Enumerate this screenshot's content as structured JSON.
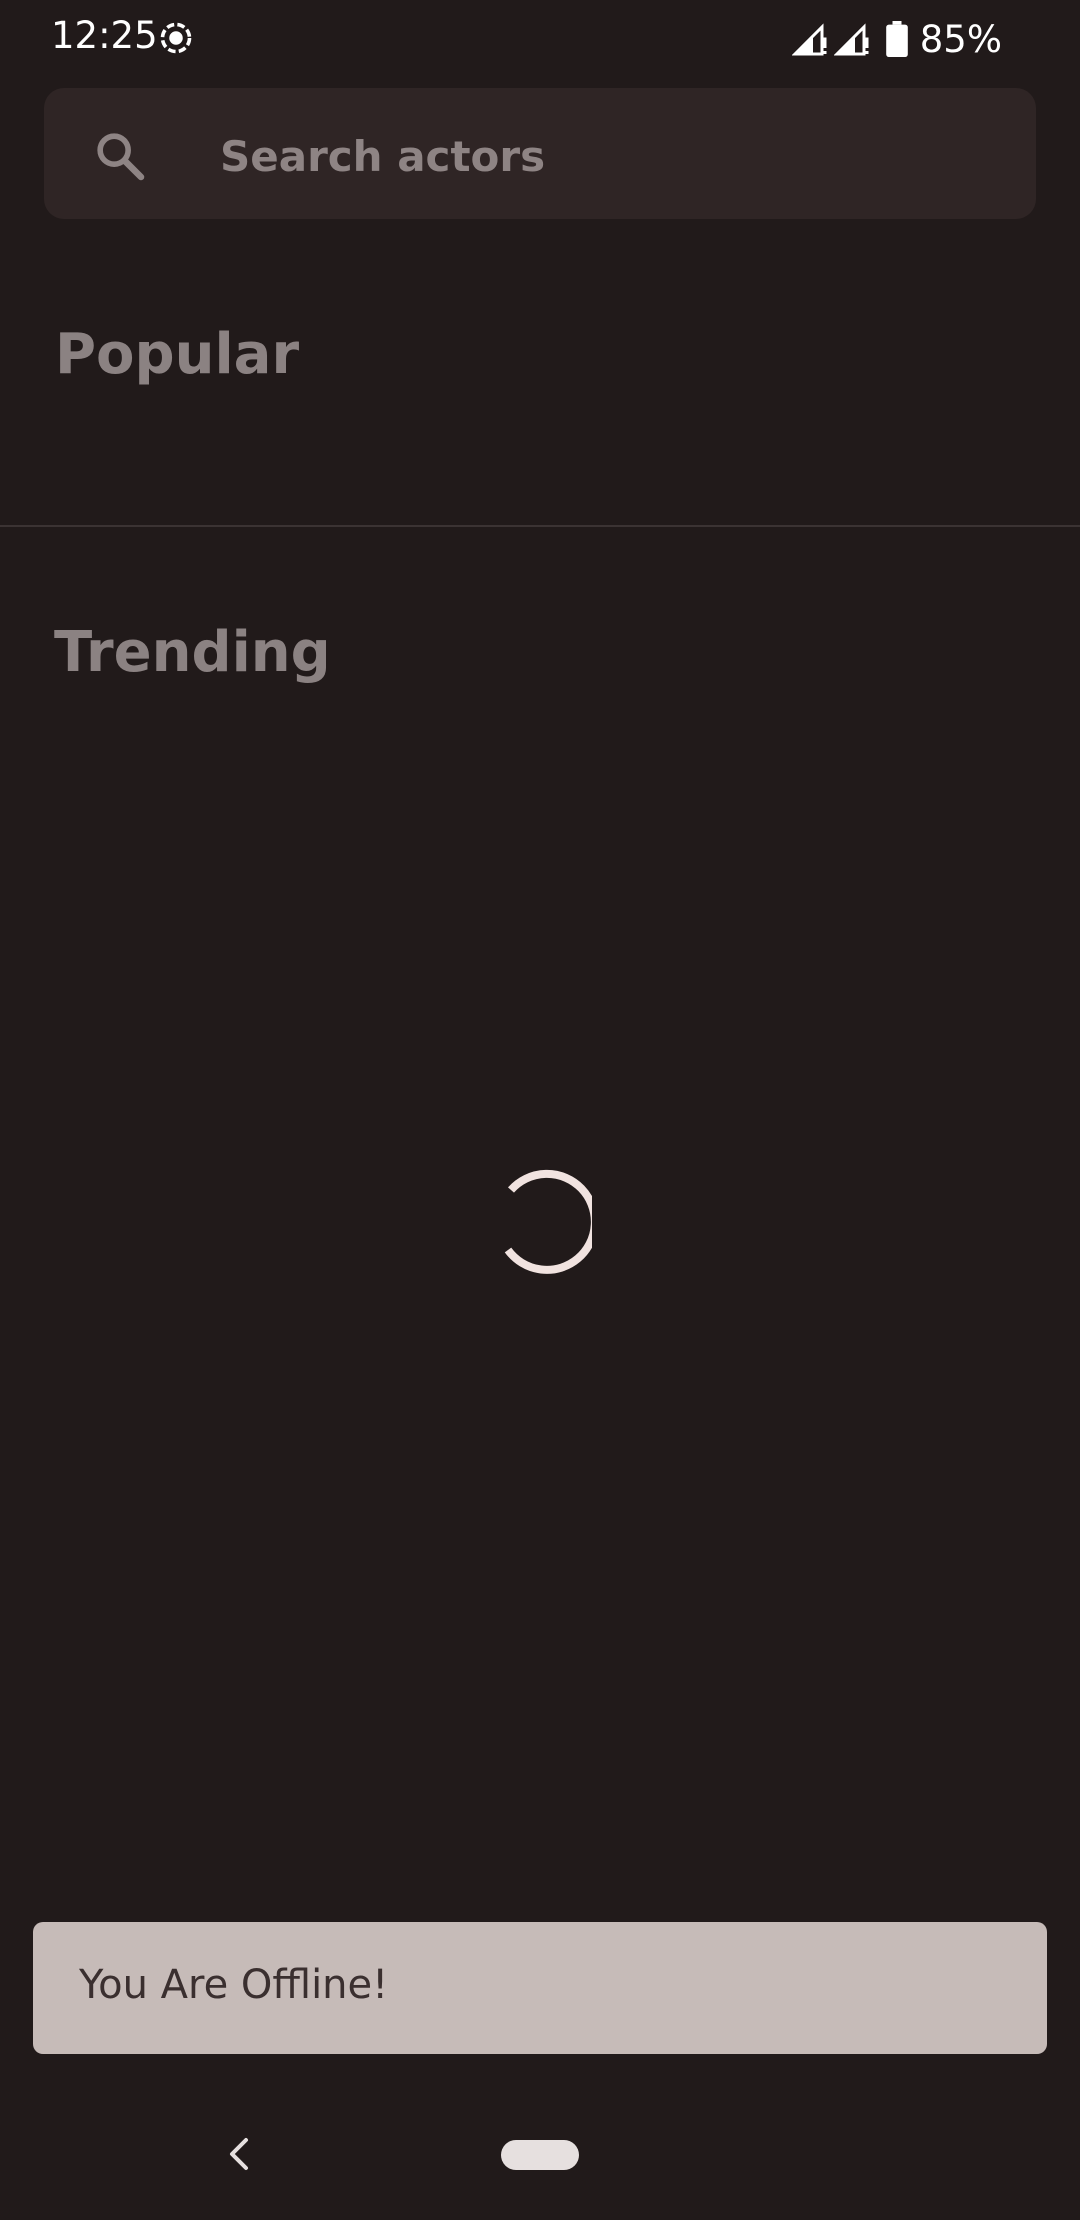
{
  "status_bar": {
    "time": "12:25",
    "battery": "85%",
    "icons": [
      "screen-record-icon",
      "signal-icon",
      "signal-icon",
      "battery-icon"
    ]
  },
  "search": {
    "placeholder": "Search actors",
    "value": "",
    "icon": "search-icon"
  },
  "sections": {
    "popular": "Popular",
    "trending": "Trending"
  },
  "loading": {
    "icon": "loading-spinner-icon"
  },
  "snackbar": {
    "message": "You Are Offline!"
  },
  "navigation": {
    "back_icon": "back-chevron-icon",
    "home_icon": "home-pill-icon"
  },
  "colors": {
    "background": "#211a1a",
    "search_background": "#2f2525",
    "section_title": "#8b8282",
    "snackbar_background": "#c6bbb8",
    "snackbar_text": "#3a2f2f",
    "spinner": "#f1e3e0"
  }
}
